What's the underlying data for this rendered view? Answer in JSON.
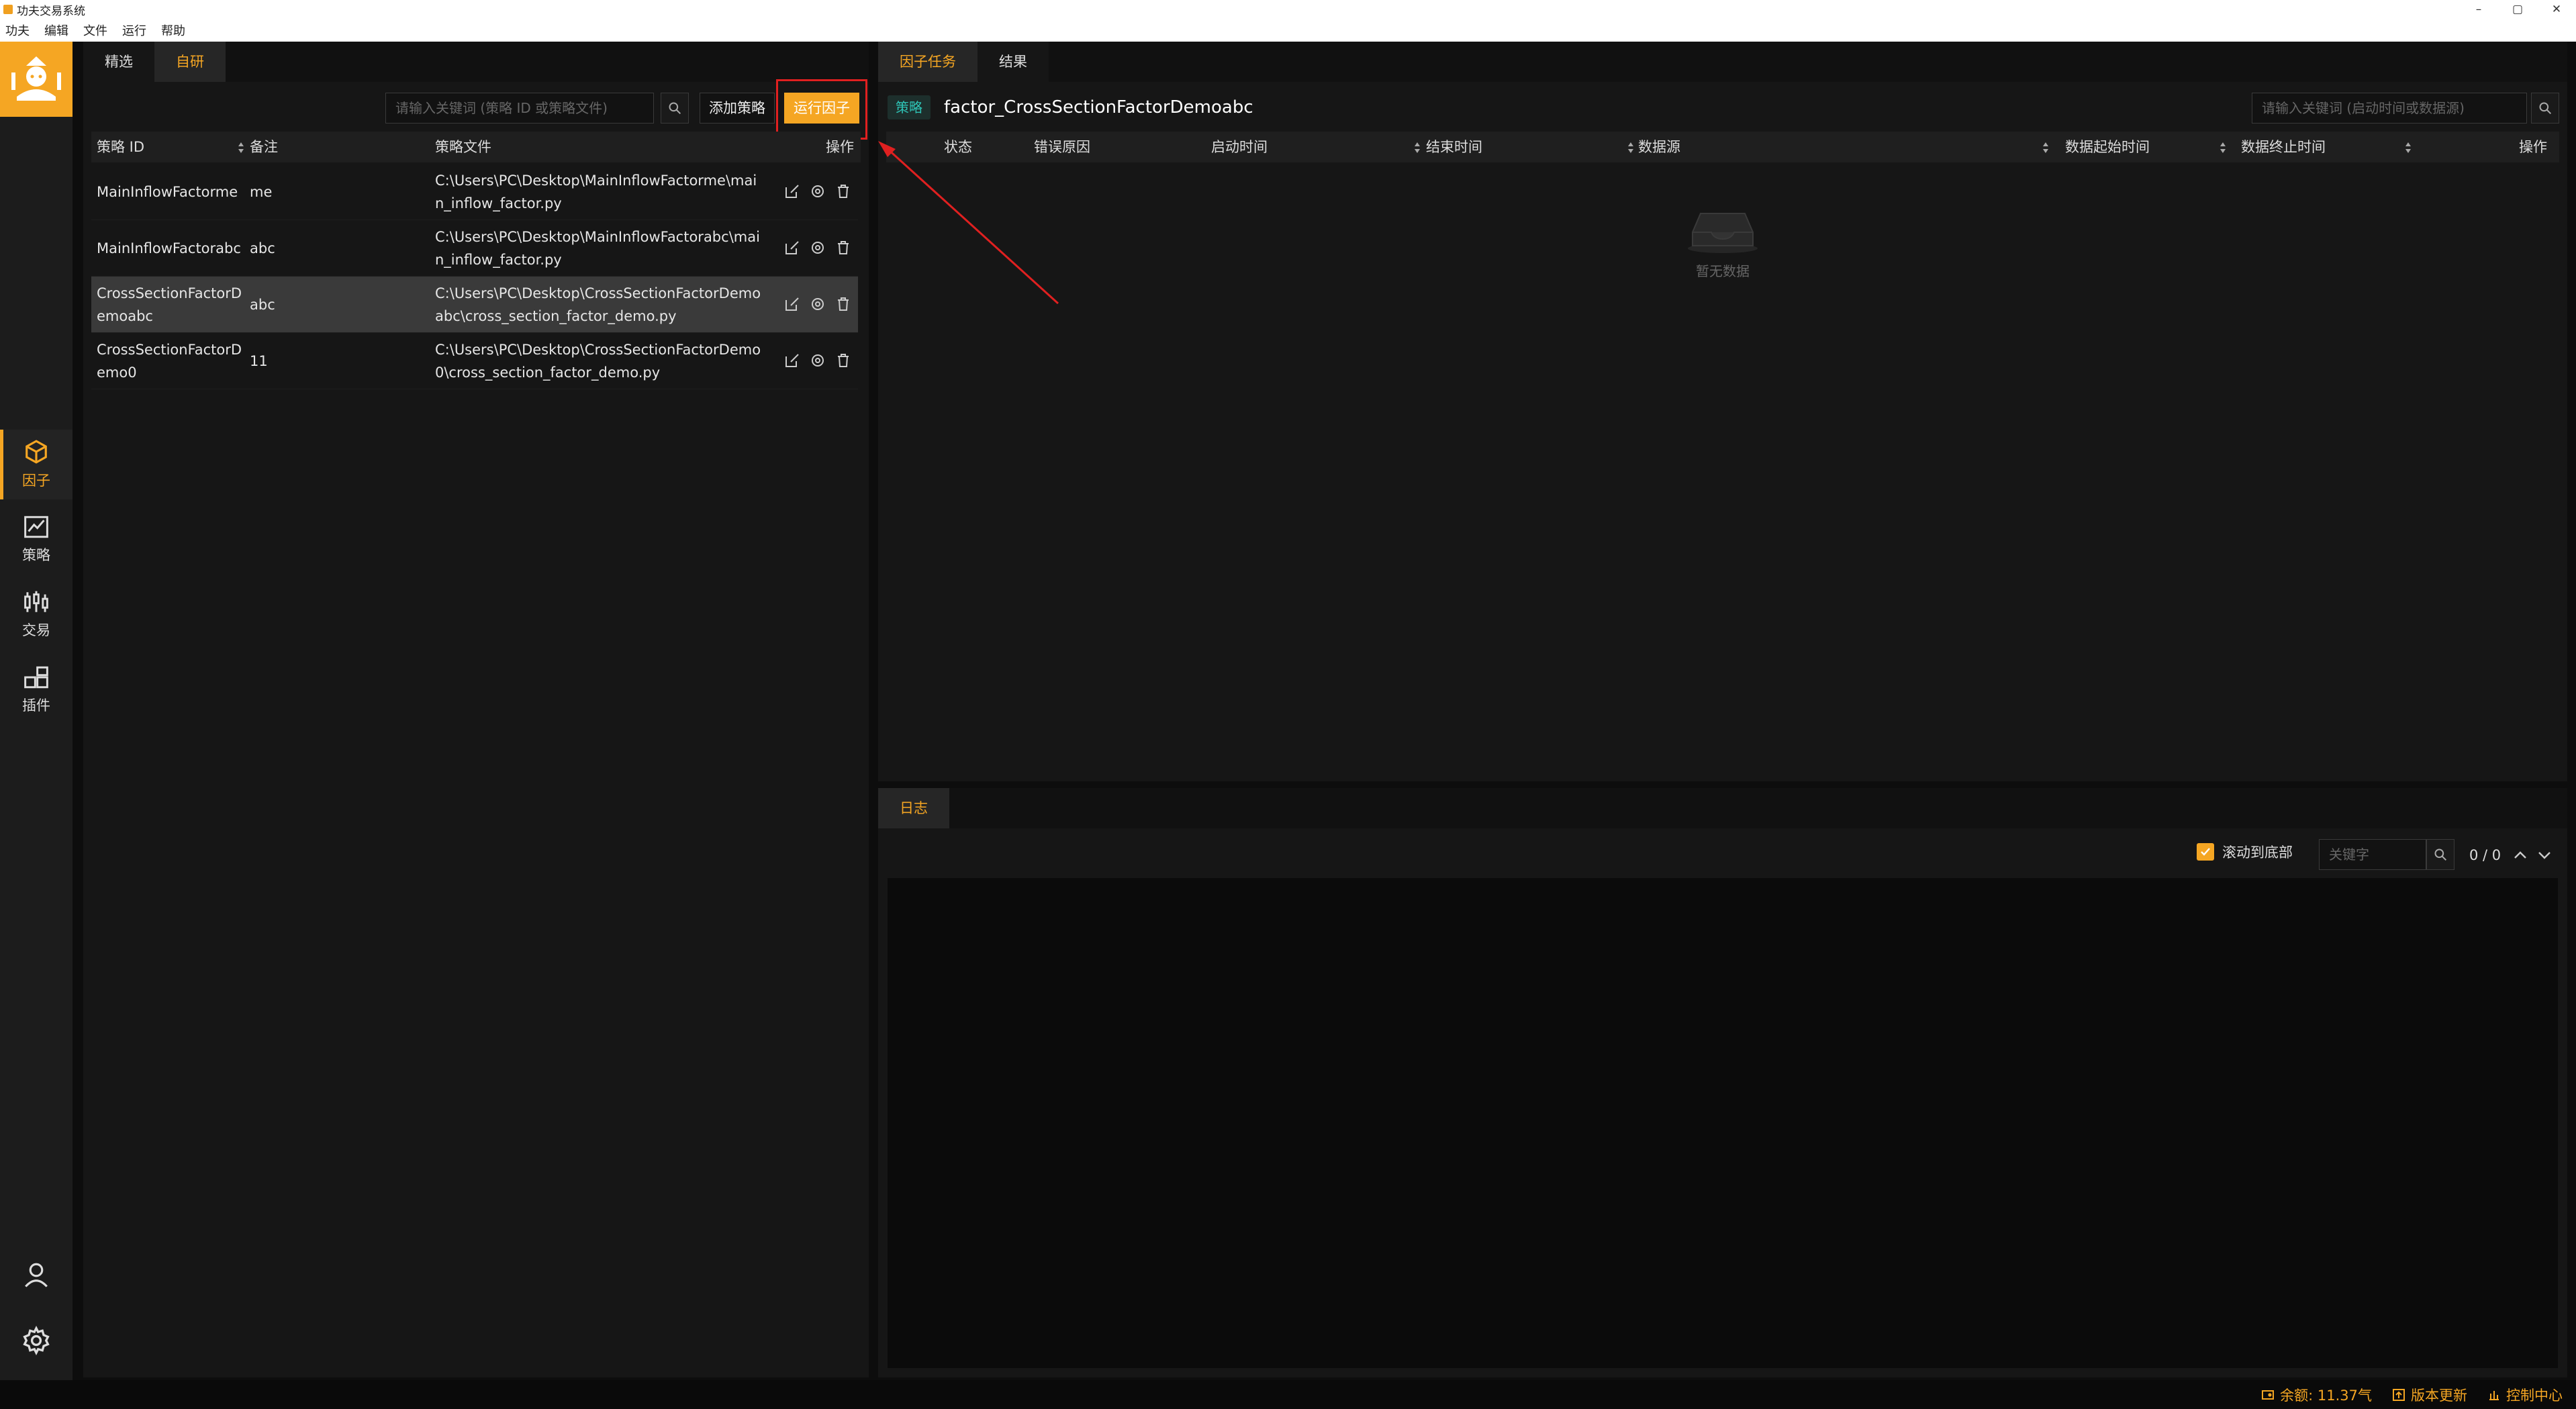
{
  "window": {
    "title": "功夫交易系统",
    "controls": [
      "–",
      "▢",
      "✕"
    ]
  },
  "menu": [
    "功夫",
    "编辑",
    "文件",
    "运行",
    "帮助"
  ],
  "sidebar": {
    "items": [
      {
        "label": "因子",
        "icon": "cube-icon"
      },
      {
        "label": "策略",
        "icon": "line-chart-icon"
      },
      {
        "label": "交易",
        "icon": "candlestick-icon"
      },
      {
        "label": "插件",
        "icon": "blocks-icon"
      }
    ],
    "active": "因子",
    "bottom_icons": [
      "user-icon",
      "gear-icon"
    ]
  },
  "left_panel": {
    "tabs": [
      "精选",
      "自研"
    ],
    "active_tab": "自研",
    "search_placeholder": "请输入关键词 (策略 ID 或策略文件)",
    "add_button": "添加策略",
    "run_button": "运行因子",
    "columns": [
      "策略 ID",
      "备注",
      "策略文件",
      "操作"
    ],
    "rows": [
      {
        "id": "MainInflowFactorme",
        "note": "me",
        "file": "C:\\Users\\PC\\Desktop\\MainInflowFactorme\\main_inflow_factor.py",
        "selected": false
      },
      {
        "id": "MainInflowFactorabc",
        "note": "abc",
        "file": "C:\\Users\\PC\\Desktop\\MainInflowFactorabc\\main_inflow_factor.py",
        "selected": false
      },
      {
        "id": "CrossSectionFactorDemoabc",
        "note": "abc",
        "file": "C:\\Users\\PC\\Desktop\\CrossSectionFactorDemoabc\\cross_section_factor_demo.py",
        "selected": true
      },
      {
        "id": "CrossSectionFactorDemo0",
        "note": "11",
        "file": "C:\\Users\\PC\\Desktop\\CrossSectionFactorDemo0\\cross_section_factor_demo.py",
        "selected": false
      }
    ]
  },
  "right_top": {
    "tabs": [
      "因子任务",
      "结果"
    ],
    "active_tab": "因子任务",
    "tag": "策略",
    "strategy_name": "factor_CrossSectionFactorDemoabc",
    "search_placeholder": "请输入关键词 (启动时间或数据源)",
    "columns": [
      "状态",
      "错误原因",
      "启动时间",
      "结束时间",
      "数据源",
      "数据起始时间",
      "数据终止时间",
      "操作"
    ],
    "empty_text": "暂无数据"
  },
  "log_panel": {
    "tab": "日志",
    "scroll_label": "滚动到底部",
    "scroll_checked": true,
    "keyword_placeholder": "关键字",
    "counter": "0 / 0"
  },
  "status": {
    "balance": "余额: 11.37气",
    "update": "版本更新",
    "control": "控制中心"
  },
  "colors": {
    "accent": "#f5a623",
    "annotation": "#e02020",
    "tag_green": "#2ec4b6"
  }
}
